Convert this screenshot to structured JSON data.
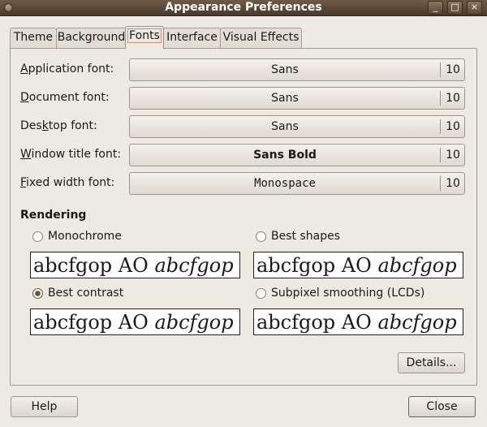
{
  "window": {
    "title": "Appearance Preferences"
  },
  "titlebar_buttons": [
    "_",
    "□",
    "×"
  ],
  "tabs": [
    {
      "label": "Theme",
      "active": false
    },
    {
      "label": "Background",
      "active": false
    },
    {
      "label": "Fonts",
      "active": true
    },
    {
      "label": "Interface",
      "active": false
    },
    {
      "label": "Visual Effects",
      "active": false
    }
  ],
  "fonts": [
    {
      "label": "Application font:",
      "mnemonic": "A",
      "rest": "pplication font:",
      "value": "Sans",
      "size": "10"
    },
    {
      "label": "Document font:",
      "mnemonic": "D",
      "rest": "ocument font:",
      "value": "Sans",
      "size": "10"
    },
    {
      "label": "Desktop font:",
      "prefix": "Des",
      "mnemonic": "k",
      "rest": "top font:",
      "value": "Sans",
      "size": "10"
    },
    {
      "label": "Window title font:",
      "mnemonic": "W",
      "rest": "indow title font:",
      "value": "Sans Bold",
      "size": "10"
    },
    {
      "label": "Fixed width font:",
      "mnemonic": "F",
      "rest": "ixed width font:",
      "value": "Monospace",
      "size": "10"
    }
  ],
  "rendering": {
    "title": "Rendering",
    "options": [
      {
        "label": "Monochrome",
        "checked": false
      },
      {
        "label": "Best shapes",
        "checked": false
      },
      {
        "label": "Best contrast",
        "checked": true
      },
      {
        "label": "Subpixel smoothing (LCDs)",
        "checked": false
      }
    ],
    "sample_regular": "abcfgop AO ",
    "sample_italic": "abcfgop"
  },
  "buttons": {
    "details": "Details...",
    "help": "Help",
    "close": "Close"
  }
}
